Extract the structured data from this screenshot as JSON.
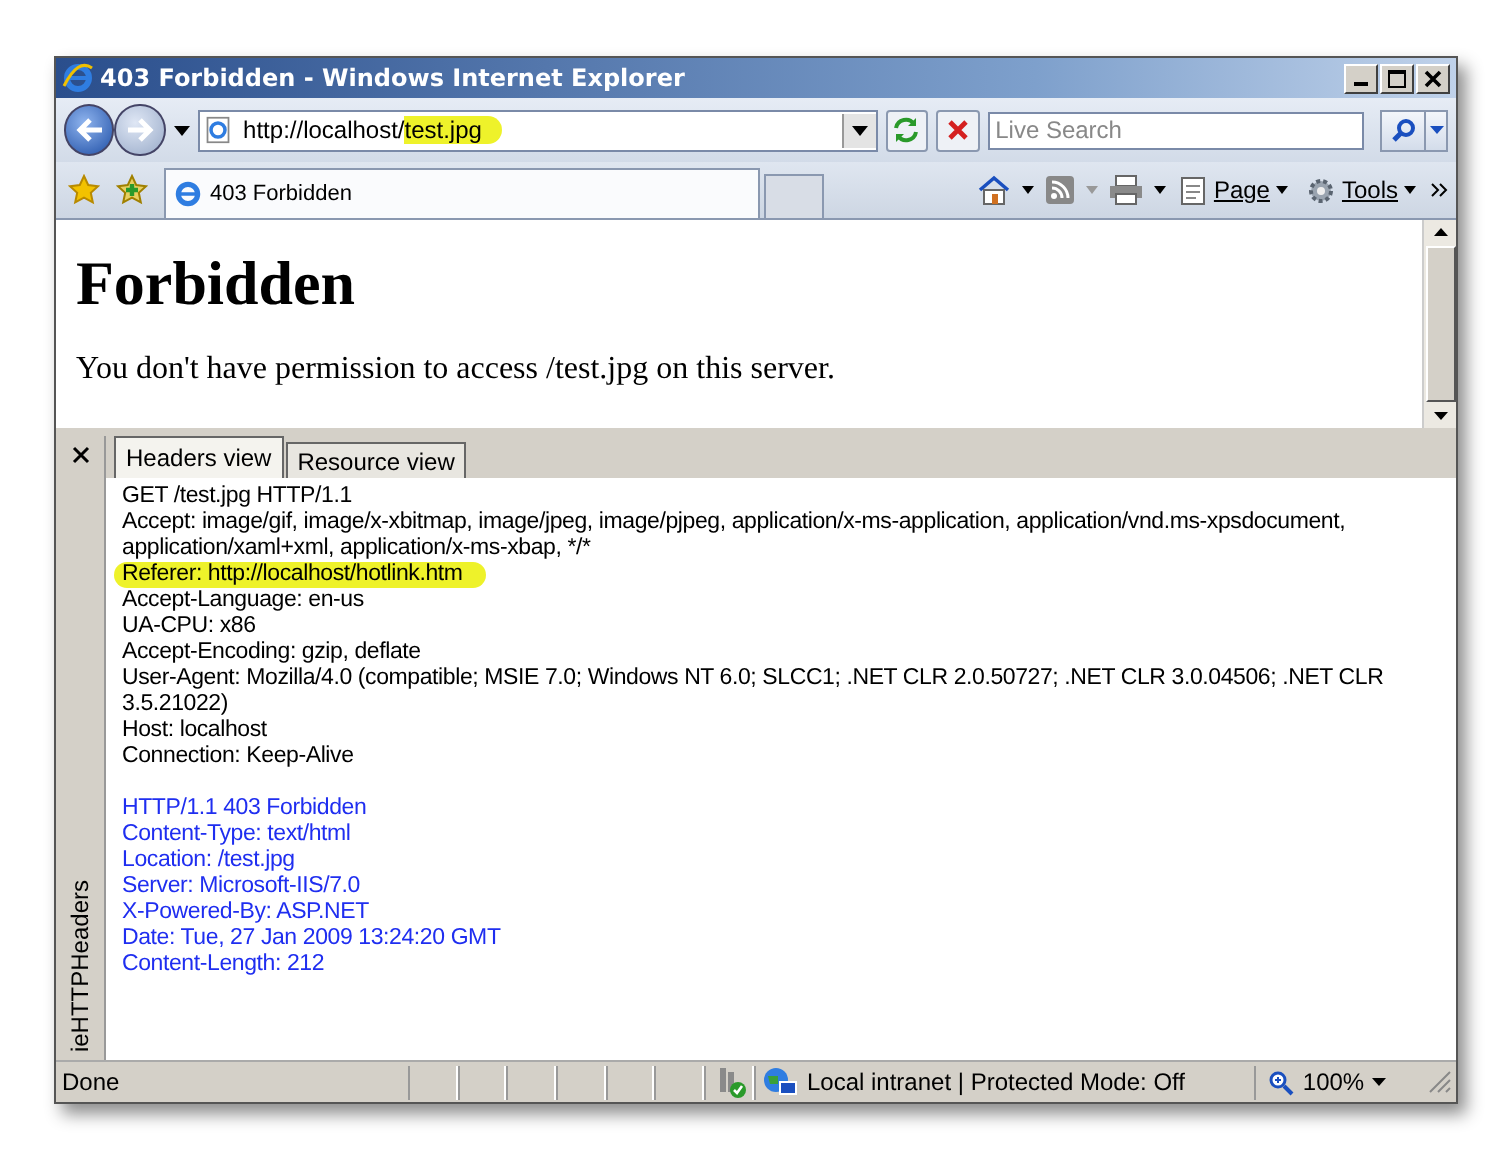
{
  "window": {
    "title": "403 Forbidden - Windows Internet Explorer"
  },
  "address_bar": {
    "url": "http://localhost/test.jpg",
    "url_highlighted": true
  },
  "search": {
    "placeholder": "Live Search"
  },
  "tabs": [
    {
      "label": "403 Forbidden",
      "selected": true
    }
  ],
  "command_bar": [
    {
      "label": "Page"
    },
    {
      "label": "Tools"
    }
  ],
  "page": {
    "heading": "Forbidden",
    "message": "You don't have permission to access /test.jpg on this server."
  },
  "explorer_bar": {
    "title": "ieHTTPHeaders",
    "tabs": [
      {
        "label": "Headers view",
        "selected": true
      },
      {
        "label": "Resource view",
        "selected": false
      }
    ],
    "lines": [
      {
        "text": "GET /test.jpg HTTP/1.1",
        "kind": "request",
        "highlighted": false
      },
      {
        "text": "Accept: image/gif, image/x-xbitmap, image/jpeg, image/pjpeg, application/x-ms-application, application/vnd.ms-xpsdocument, application/xaml+xml, application/x-ms-xbap, */*",
        "kind": "request",
        "highlighted": false
      },
      {
        "text": "Referer: http://localhost/hotlink.htm",
        "kind": "request",
        "highlighted": true
      },
      {
        "text": "Accept-Language: en-us",
        "kind": "request",
        "highlighted": false
      },
      {
        "text": "UA-CPU: x86",
        "kind": "request",
        "highlighted": false
      },
      {
        "text": "Accept-Encoding: gzip, deflate",
        "kind": "request",
        "highlighted": false
      },
      {
        "text": "User-Agent: Mozilla/4.0 (compatible; MSIE 7.0; Windows NT 6.0; SLCC1; .NET CLR 2.0.50727; .NET CLR 3.0.04506; .NET CLR 3.5.21022)",
        "kind": "request",
        "highlighted": false
      },
      {
        "text": "Host: localhost",
        "kind": "request",
        "highlighted": false
      },
      {
        "text": "Connection: Keep-Alive",
        "kind": "request",
        "highlighted": false
      },
      {
        "kind": "blank"
      },
      {
        "text": "HTTP/1.1 403 Forbidden",
        "kind": "response",
        "highlighted": false
      },
      {
        "text": "Content-Type: text/html",
        "kind": "response",
        "highlighted": false
      },
      {
        "text": "Location: /test.jpg",
        "kind": "response",
        "highlighted": false
      },
      {
        "text": "Server: Microsoft-IIS/7.0",
        "kind": "response",
        "highlighted": false
      },
      {
        "text": "X-Powered-By: ASP.NET",
        "kind": "response",
        "highlighted": false
      },
      {
        "text": "Date: Tue, 27 Jan 2009 13:24:20 GMT",
        "kind": "response",
        "highlighted": false
      },
      {
        "text": "Content-Length: 212",
        "kind": "response",
        "highlighted": false
      }
    ]
  },
  "status_bar": {
    "status": "Done",
    "zone": "Local intranet | Protected Mode: Off",
    "zoom": "100%"
  }
}
